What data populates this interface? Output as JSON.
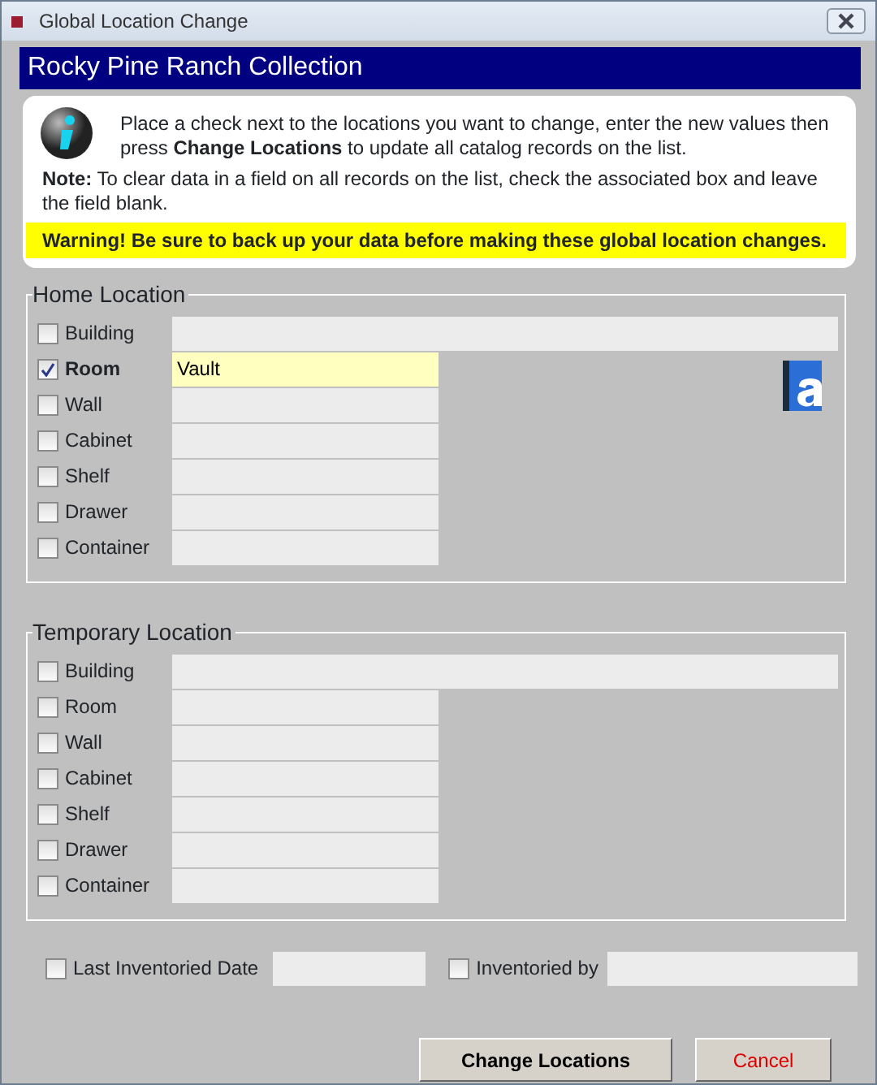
{
  "window": {
    "title": "Global Location Change"
  },
  "header": "Rocky Pine Ranch Collection",
  "info": {
    "text": "Place a check next to the locations you want to change, enter the new values then press **Change Locations** to update all catalog records on the list.",
    "note": "**Note:** To clear data in a field on all records on the list, check the associated box and leave the field blank.",
    "warning": "Warning! Be sure to back up your data before making these global location changes."
  },
  "sections": [
    {
      "title": "Home Location",
      "rows": [
        {
          "label": "Building",
          "checked": false
        },
        {
          "label": "Room",
          "checked": true,
          "value": "Vault"
        },
        {
          "label": "Wall",
          "checked": false
        },
        {
          "label": "Cabinet",
          "checked": false
        },
        {
          "label": "Shelf",
          "checked": false
        },
        {
          "label": "Drawer",
          "checked": false
        },
        {
          "label": "Container",
          "checked": false
        }
      ]
    },
    {
      "title": "Temporary Location",
      "rows": [
        {
          "label": "Building",
          "checked": false
        },
        {
          "label": "Room",
          "checked": false
        },
        {
          "label": "Wall",
          "checked": false
        },
        {
          "label": "Cabinet",
          "checked": false
        },
        {
          "label": "Shelf",
          "checked": false
        },
        {
          "label": "Drawer",
          "checked": false
        },
        {
          "label": "Container",
          "checked": false
        }
      ]
    }
  ],
  "extra_fields": [
    {
      "label": "Last Inventoried Date",
      "checked": false
    },
    {
      "label": "Inventoried by",
      "checked": false
    }
  ],
  "buttons": [
    {
      "label": "Change Locations",
      "kind": "primary"
    },
    {
      "label": "Cancel",
      "kind": "cancel"
    }
  ]
}
